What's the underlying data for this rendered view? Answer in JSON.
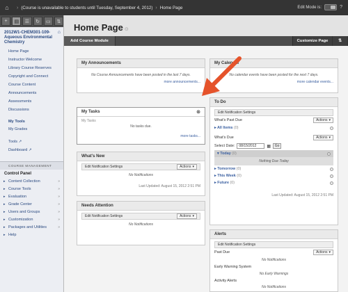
{
  "topbar": {
    "breadcrumb_course": "(Course is unavailable to students until Tuesday, September 4, 2012)",
    "breadcrumb_page": "Home Page",
    "edit_mode_label": "Edit Mode is:"
  },
  "sidebar": {
    "course_title": "2012W1-CHEM301-109-Aqueous Environmental Chemistry",
    "menu": [
      {
        "label": "Home Page"
      },
      {
        "label": "Instructor Welcome"
      },
      {
        "label": "Library Course Reserves"
      },
      {
        "label": "Copyright and Connect"
      },
      {
        "label": "Course Content"
      },
      {
        "label": "Announcements"
      },
      {
        "label": "Assessments"
      },
      {
        "label": "Discussions"
      }
    ],
    "my_tools": "My Tools",
    "my_grades": "My Grades",
    "tools": "Tools",
    "dashboard": "Dashboard",
    "course_management": "COURSE MANAGEMENT",
    "control_panel": "Control Panel",
    "control_items": [
      {
        "label": "Content Collection"
      },
      {
        "label": "Course Tools"
      },
      {
        "label": "Evaluation"
      },
      {
        "label": "Grade Center"
      },
      {
        "label": "Users and Groups"
      },
      {
        "label": "Customization"
      },
      {
        "label": "Packages and Utilities"
      },
      {
        "label": "Help"
      }
    ]
  },
  "main": {
    "page_title": "Home Page",
    "add_module": "Add Course Module",
    "customize_page": "Customize Page"
  },
  "modules": {
    "announcements": {
      "title": "My Announcements",
      "note": "No Course Announcements have been posted in the last 7 days.",
      "link": "more announcements..."
    },
    "calendar": {
      "title": "My Calendar",
      "note": "No calendar events have been posted for the next 7 days.",
      "link": "more calendar events..."
    },
    "tasks": {
      "title": "My Tasks",
      "sub": "My Tasks",
      "note": "No tasks due.",
      "link": "more tasks..."
    },
    "whats_new": {
      "title": "What's New",
      "notif": "Edit Notification Settings",
      "actions": "Actions",
      "note": "No Notifications",
      "updated": "Last Updated: August 15, 2012 2:51 PM"
    },
    "needs_attention": {
      "title": "Needs Attention",
      "notif": "Edit Notification Settings",
      "actions": "Actions",
      "note": "No Notifications",
      "updated": "Last Updated: August 15, 2012 2:51 PM"
    },
    "todo": {
      "title": "To Do",
      "notif": "Edit Notification Settings",
      "past_due": "What's Past Due",
      "actions": "Actions",
      "all_items": "All Items",
      "all_items_count": "(0)",
      "whats_due": "What's Due",
      "select_date": "Select Date:",
      "date_value": "08/15/2012",
      "go": "Go",
      "today": "Today",
      "today_count": "(0)",
      "nothing_due": "Nothing Due Today",
      "tomorrow": "Tomorrow",
      "tomorrow_count": "(0)",
      "this_week": "This Week",
      "this_week_count": "(0)",
      "future": "Future",
      "future_count": "(0)",
      "updated": "Last Updated: August 15, 2012 2:51 PM"
    },
    "alerts": {
      "title": "Alerts",
      "notif": "Edit Notification Settings",
      "past_due": "Past Due",
      "actions": "Actions",
      "no_notifs": "No Notifications",
      "early_warning": "Early Warning System",
      "no_early": "No Early Warnings",
      "activity": "Activity Alerts",
      "no_notifs2": "No Notifications"
    }
  },
  "colors": {
    "link": "#3a5fa0",
    "arrow": "#e5532b"
  }
}
